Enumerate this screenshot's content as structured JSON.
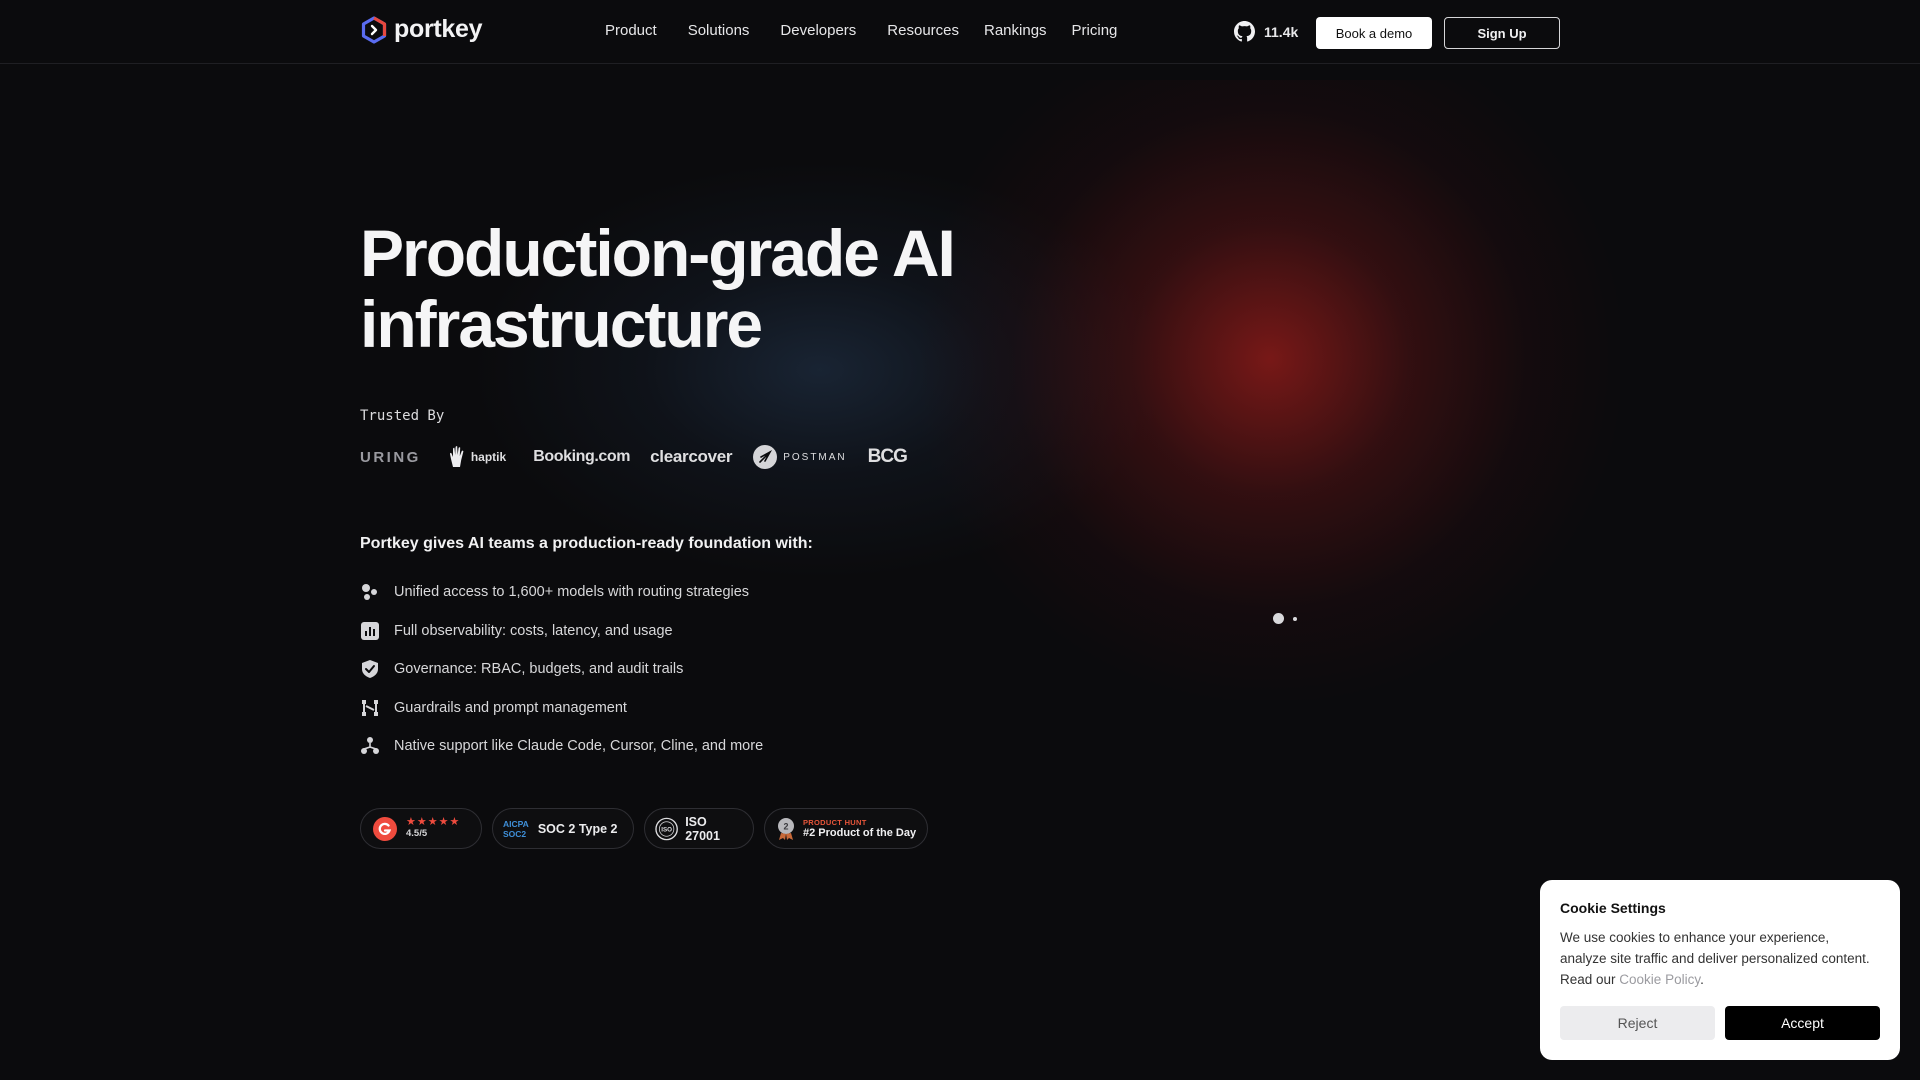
{
  "nav": {
    "logo_text": "portkey",
    "links": [
      "Product",
      "Solutions",
      "Developers",
      "Resources",
      "Rankings",
      "Pricing"
    ],
    "github_count": "11.4k",
    "book_demo": "Book a demo",
    "sign_up": "Sign Up"
  },
  "hero": {
    "title_line1": "Production-grade AI",
    "title_line2": "infrastructure",
    "trusted_label": "Trusted By",
    "logos": [
      "URING",
      "haptik",
      "Booking.com",
      "clearcover",
      "POSTMAN",
      "BCG"
    ],
    "foundation": "Portkey gives AI teams a production-ready foundation with:",
    "features": [
      {
        "icon": "models-icon",
        "text": "Unified access to 1,600+ models with routing strategies"
      },
      {
        "icon": "chart-icon",
        "text": "Full observability: costs, latency, and usage"
      },
      {
        "icon": "shield-check-icon",
        "text": "Governance: RBAC, budgets, and audit trails"
      },
      {
        "icon": "guardrails-icon",
        "text": "Guardrails and prompt management"
      },
      {
        "icon": "integrations-icon",
        "text": "Native support like Claude Code, Cursor, Cline, and more"
      }
    ]
  },
  "badges": {
    "g2_rating": "4.5/5",
    "g2_stars": "★★★★★",
    "aicpa_line1": "AICPA",
    "aicpa_line2": "SOC2",
    "soc2": "SOC 2 Type 2",
    "iso_mark": "ISO",
    "iso": "ISO 27001",
    "ph_top": "PRODUCT HUNT",
    "ph_bottom": "#2 Product of the Day"
  },
  "cookie": {
    "title": "Cookie Settings",
    "text": "We use cookies to enhance your experience, analyze site traffic and deliver personalized content. Read our ",
    "link": "Cookie Policy",
    "period": ".",
    "reject": "Reject",
    "accept": "Accept"
  },
  "colors": {
    "background": "#0b0b0d",
    "accent_red": "#961c1a",
    "g2_red": "#ef4b3e",
    "product_hunt": "#e7553a",
    "aicpa_blue": "#3f8fd8"
  }
}
